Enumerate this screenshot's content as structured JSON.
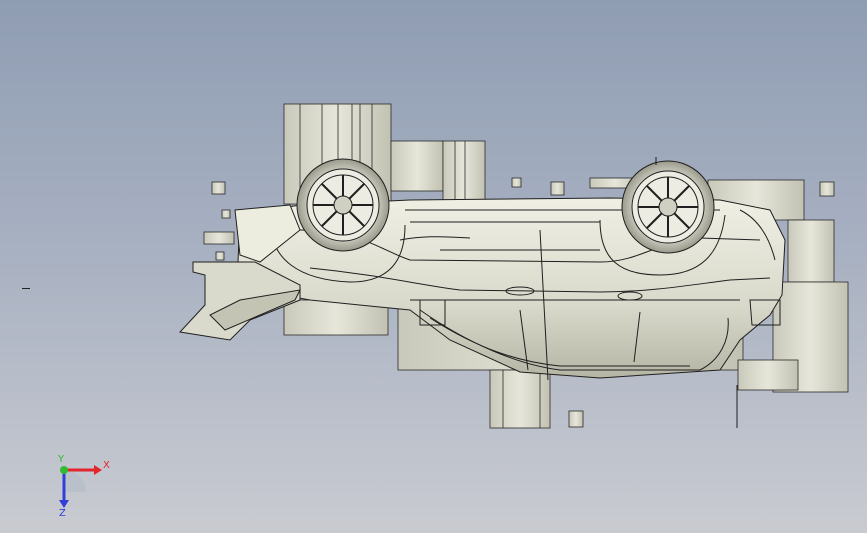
{
  "viewport": {
    "background_top": "#8f9db3",
    "background_bottom": "#c9cbd1",
    "part_fill": "#e3e3d6",
    "part_shadow": "#b9b9a9",
    "edge_color": "#1f1f1f"
  },
  "triad": {
    "x_label": "X",
    "y_label": "Y",
    "z_label": "Z",
    "x_color": "#e3262d",
    "y_color": "#2ebd2e",
    "z_color": "#2f3fd8"
  },
  "model": {
    "description_icon": "upside-down-car-model",
    "wheel_count": 2
  }
}
